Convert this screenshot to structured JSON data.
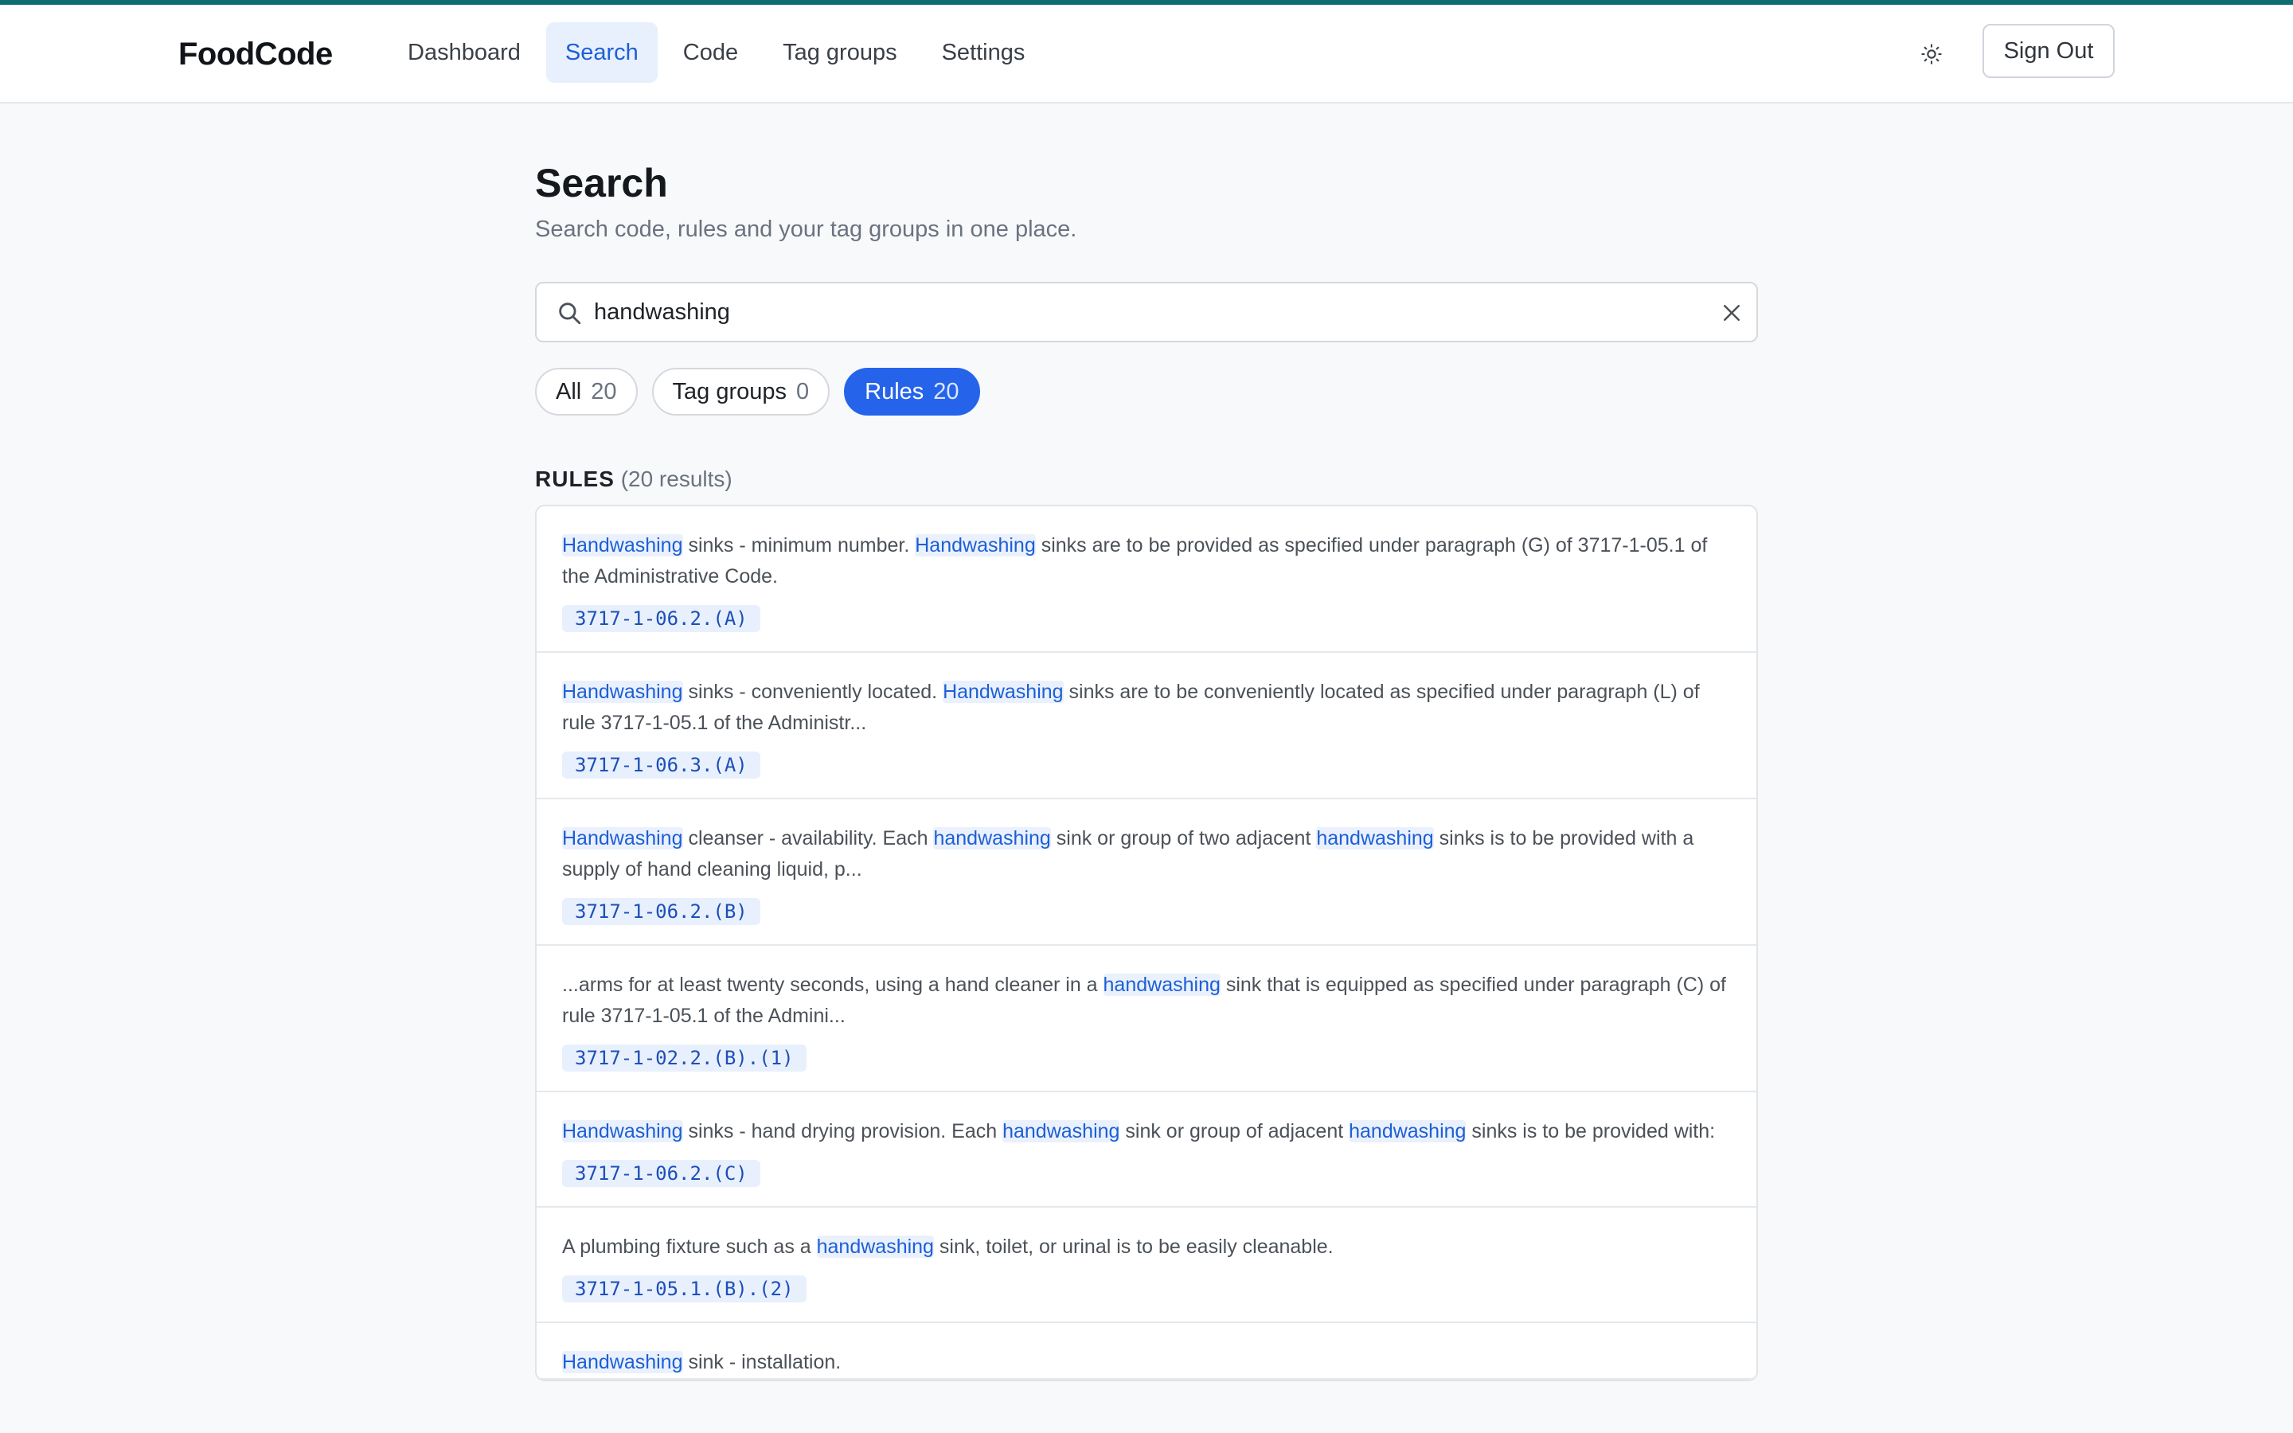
{
  "app": {
    "name": "FoodCode"
  },
  "nav": {
    "items": [
      {
        "label": "Dashboard",
        "active": false
      },
      {
        "label": "Search",
        "active": true
      },
      {
        "label": "Code",
        "active": false
      },
      {
        "label": "Tag groups",
        "active": false
      },
      {
        "label": "Settings",
        "active": false
      }
    ],
    "theme_icon": "sun-icon",
    "sign_out_label": "Sign Out"
  },
  "page": {
    "title": "Search",
    "subtitle": "Search code, rules and your tag groups in one place."
  },
  "search": {
    "value": "handwashing",
    "icons": {
      "search": "search-icon",
      "clear": "close-icon"
    }
  },
  "filters": [
    {
      "label": "All",
      "count": "20",
      "active": false
    },
    {
      "label": "Tag groups",
      "count": "0",
      "active": false
    },
    {
      "label": "Rules",
      "count": "20",
      "active": true
    }
  ],
  "rules_section": {
    "title": "RULES",
    "count_text": "(20 results)"
  },
  "results": [
    {
      "segments": [
        {
          "t": "Handwashing",
          "h": true
        },
        {
          "t": " sinks - minimum number. ",
          "h": false
        },
        {
          "t": "Handwashing",
          "h": true
        },
        {
          "t": " sinks are to be provided as specified under paragraph (G) of 3717-1-05.1 of the Administrative Code.",
          "h": false
        }
      ],
      "code": "3717-1-06.2.(A)"
    },
    {
      "segments": [
        {
          "t": "Handwashing",
          "h": true
        },
        {
          "t": " sinks - conveniently located. ",
          "h": false
        },
        {
          "t": "Handwashing",
          "h": true
        },
        {
          "t": " sinks are to be conveniently located as specified under paragraph (L) of rule 3717-1-05.1 of the Administr...",
          "h": false
        }
      ],
      "code": "3717-1-06.3.(A)"
    },
    {
      "segments": [
        {
          "t": "Handwashing",
          "h": true
        },
        {
          "t": " cleanser - availability. Each ",
          "h": false
        },
        {
          "t": "handwashing",
          "h": true
        },
        {
          "t": " sink or group of two adjacent ",
          "h": false
        },
        {
          "t": "handwashing",
          "h": true
        },
        {
          "t": " sinks is to be provided with a supply of hand cleaning liquid, p...",
          "h": false
        }
      ],
      "code": "3717-1-06.2.(B)"
    },
    {
      "segments": [
        {
          "t": "...arms for at least twenty seconds, using a hand cleaner in a ",
          "h": false
        },
        {
          "t": "handwashing",
          "h": true
        },
        {
          "t": " sink that is equipped as specified under paragraph (C) of rule 3717-1-05.1 of the Admini...",
          "h": false
        }
      ],
      "code": "3717-1-02.2.(B).(1)"
    },
    {
      "segments": [
        {
          "t": "Handwashing",
          "h": true
        },
        {
          "t": " sinks - hand drying provision. Each ",
          "h": false
        },
        {
          "t": "handwashing",
          "h": true
        },
        {
          "t": " sink or group of adjacent ",
          "h": false
        },
        {
          "t": "handwashing",
          "h": true
        },
        {
          "t": " sinks is to be provided with:",
          "h": false
        }
      ],
      "code": "3717-1-06.2.(C)"
    },
    {
      "segments": [
        {
          "t": "A plumbing fixture such as a ",
          "h": false
        },
        {
          "t": "handwashing",
          "h": true
        },
        {
          "t": " sink, toilet, or urinal is to be easily cleanable.",
          "h": false
        }
      ],
      "code": "3717-1-05.1.(B).(2)"
    },
    {
      "segments": [
        {
          "t": "Handwashing",
          "h": true
        },
        {
          "t": " sink - installation.",
          "h": false
        }
      ],
      "code": ""
    }
  ]
}
